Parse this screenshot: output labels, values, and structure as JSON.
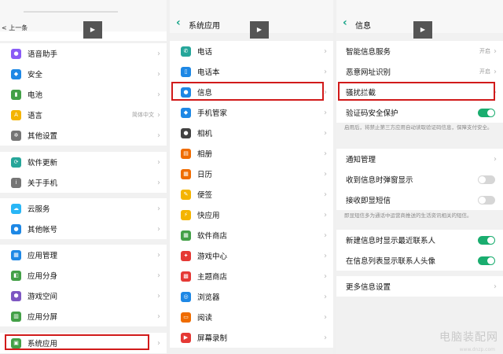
{
  "colors": {
    "accent": "#17a589",
    "highlight": "#d11a1a",
    "toggle_on": "#1aad6f",
    "toggle_off": "#d6d6d6"
  },
  "play_label": "▶",
  "panel1": {
    "back_label": "< 上一条",
    "items": [
      {
        "label": "语音助手",
        "icon": "mic-icon",
        "color": "#8a5cf6"
      },
      {
        "label": "安全",
        "icon": "shield-icon",
        "color": "#1e88e5"
      },
      {
        "label": "电池",
        "icon": "battery-icon",
        "color": "#43a047"
      },
      {
        "label": "语言",
        "icon": "language-icon",
        "color": "#f4b400",
        "value": "简体中文"
      },
      {
        "label": "其他设置",
        "icon": "gear-icon",
        "color": "#757575"
      },
      {
        "label": "软件更新",
        "icon": "update-icon",
        "color": "#26a69a"
      },
      {
        "label": "关于手机",
        "icon": "info-icon",
        "color": "#757575"
      },
      {
        "label": "云服务",
        "icon": "cloud-icon",
        "color": "#29b6f6"
      },
      {
        "label": "其他帐号",
        "icon": "account-icon",
        "color": "#1e88e5"
      },
      {
        "label": "应用管理",
        "icon": "apps-icon",
        "color": "#1e88e5"
      },
      {
        "label": "应用分身",
        "icon": "clone-icon",
        "color": "#43a047"
      },
      {
        "label": "游戏空间",
        "icon": "game-icon",
        "color": "#7e57c2"
      },
      {
        "label": "应用分屏",
        "icon": "split-screen-icon",
        "color": "#43a047"
      },
      {
        "label": "系统应用",
        "icon": "system-apps-icon",
        "color": "#43a047"
      }
    ]
  },
  "panel2": {
    "title": "系统应用",
    "items": [
      {
        "label": "电话",
        "icon": "phone-icon",
        "color": "#26a69a"
      },
      {
        "label": "电话本",
        "icon": "contacts-icon",
        "color": "#1e88e5"
      },
      {
        "label": "信息",
        "icon": "message-icon",
        "color": "#1e88e5"
      },
      {
        "label": "手机管家",
        "icon": "shield-icon",
        "color": "#1e88e5"
      },
      {
        "label": "相机",
        "icon": "camera-icon",
        "color": "#424242"
      },
      {
        "label": "相册",
        "icon": "gallery-icon",
        "color": "#ef6c00"
      },
      {
        "label": "日历",
        "icon": "calendar-icon",
        "color": "#ef6c00"
      },
      {
        "label": "便签",
        "icon": "notes-icon",
        "color": "#f4b400"
      },
      {
        "label": "快应用",
        "icon": "flash-icon",
        "color": "#f4b400"
      },
      {
        "label": "软件商店",
        "icon": "store-icon",
        "color": "#43a047"
      },
      {
        "label": "游戏中心",
        "icon": "game-center-icon",
        "color": "#e53935"
      },
      {
        "label": "主题商店",
        "icon": "theme-icon",
        "color": "#e53935"
      },
      {
        "label": "浏览器",
        "icon": "browser-icon",
        "color": "#1e88e5"
      },
      {
        "label": "阅读",
        "icon": "book-icon",
        "color": "#ef6c00"
      },
      {
        "label": "屏幕录制",
        "icon": "record-icon",
        "color": "#e53935"
      }
    ]
  },
  "panel3": {
    "title": "信息",
    "items": [
      {
        "label": "智能信息服务",
        "value": "开启"
      },
      {
        "label": "恶意网址识别",
        "value": "开启"
      },
      {
        "label": "骚扰拦截"
      },
      {
        "label": "验证码安全保护",
        "toggle": "on"
      },
      {
        "label": "通知管理"
      },
      {
        "label": "收到信息时弹窗显示",
        "toggle": "off"
      },
      {
        "label": "接收即显短信",
        "toggle": "off"
      },
      {
        "label": "新建信息时显示最近联系人",
        "toggle": "on"
      },
      {
        "label": "在信息列表显示联系人头像",
        "toggle": "on"
      },
      {
        "label": "更多信息设置"
      }
    ],
    "notes": [
      "启用后，将禁止第三方应用自动读取验证码信息，保障支付安全。",
      "即显短信多为通话中运营商推送的生活资讯相关的短信。"
    ]
  },
  "watermark": {
    "main": "电脑装配网",
    "sub": "www.dnzp.com"
  }
}
